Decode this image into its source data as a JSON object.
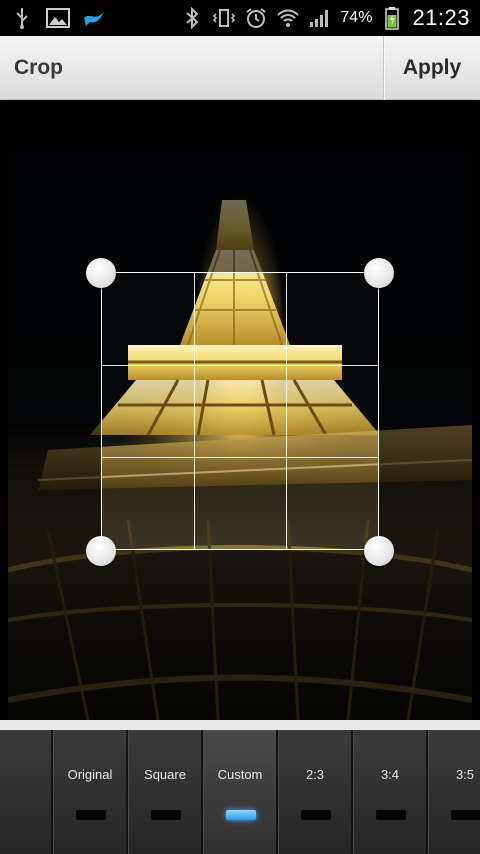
{
  "status_bar": {
    "battery_percent": "74%",
    "time": "21:23",
    "icons": [
      "usb-icon",
      "gallery-icon",
      "bird-app-icon",
      "bluetooth-icon",
      "vibrate-icon",
      "alarm-icon",
      "wifi-icon",
      "signal-icon",
      "battery-charging-icon"
    ]
  },
  "action_bar": {
    "title": "Crop",
    "apply_label": "Apply"
  },
  "crop": {
    "grid": "3x3",
    "handles": [
      "top-left",
      "top-right",
      "bottom-left",
      "bottom-right"
    ]
  },
  "aspect_options": {
    "selected": "Custom",
    "items": [
      {
        "label": ""
      },
      {
        "label": "Original"
      },
      {
        "label": "Square"
      },
      {
        "label": "Custom"
      },
      {
        "label": "2:3"
      },
      {
        "label": "3:4"
      },
      {
        "label": "3:5"
      }
    ]
  },
  "colors": {
    "selected_indicator": "#2f9be8",
    "action_bar_bg": "#e6e6e6"
  }
}
